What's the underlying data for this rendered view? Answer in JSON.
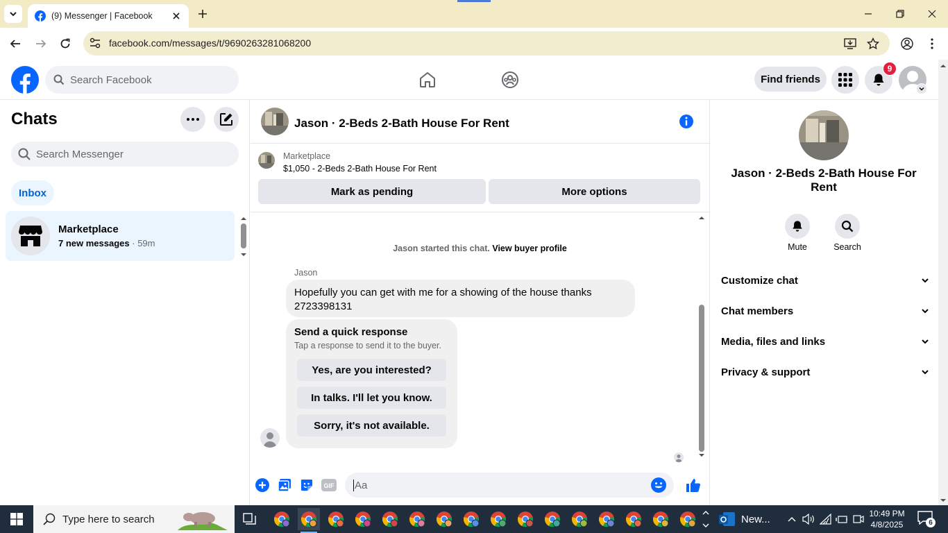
{
  "browser": {
    "tab_title": "(9) Messenger | Facebook",
    "url": "facebook.com/messages/t/9690263281068200"
  },
  "header": {
    "search_placeholder": "Search Facebook",
    "find_friends": "Find friends",
    "notification_count": "9"
  },
  "chats": {
    "title": "Chats",
    "search_placeholder": "Search Messenger",
    "inbox_label": "Inbox",
    "items": [
      {
        "name": "Marketplace",
        "preview": "7 new messages",
        "time": "59m"
      }
    ]
  },
  "conversation": {
    "title": "Jason · 2-Beds 2-Bath House For Rent",
    "marketplace_label": "Marketplace",
    "listing": "$1,050 - 2-Beds 2-Bath House For Rent",
    "mark_pending": "Mark as pending",
    "more_options": "More options",
    "system_text": "Jason started this chat.",
    "system_link": "View buyer profile",
    "sender_name": "Jason",
    "message": "Hopefully you can get with me for a showing of the house thanks 2723398131",
    "quick_title": "Send a quick response",
    "quick_subtitle": "Tap a response to send it to the buyer.",
    "quick_responses": [
      "Yes, are you interested?",
      "In talks. I'll let you know.",
      "Sorry, it's not available."
    ],
    "composer_placeholder": "Aa"
  },
  "details": {
    "name": "Jason · 2-Beds 2-Bath House For Rent",
    "actions": [
      {
        "label": "Mute"
      },
      {
        "label": "Search"
      }
    ],
    "sections": [
      "Customize chat",
      "Chat members",
      "Media, files and links",
      "Privacy & support"
    ]
  },
  "taskbar": {
    "search_placeholder": "Type here to search",
    "news_label": "New...",
    "time": "10:49 PM",
    "date": "4/8/2025",
    "notification_count": "6"
  },
  "colors": {
    "facebook_blue": "#0866ff",
    "badge_red": "#e41e3f",
    "selected_bg": "#ebf5ff"
  }
}
